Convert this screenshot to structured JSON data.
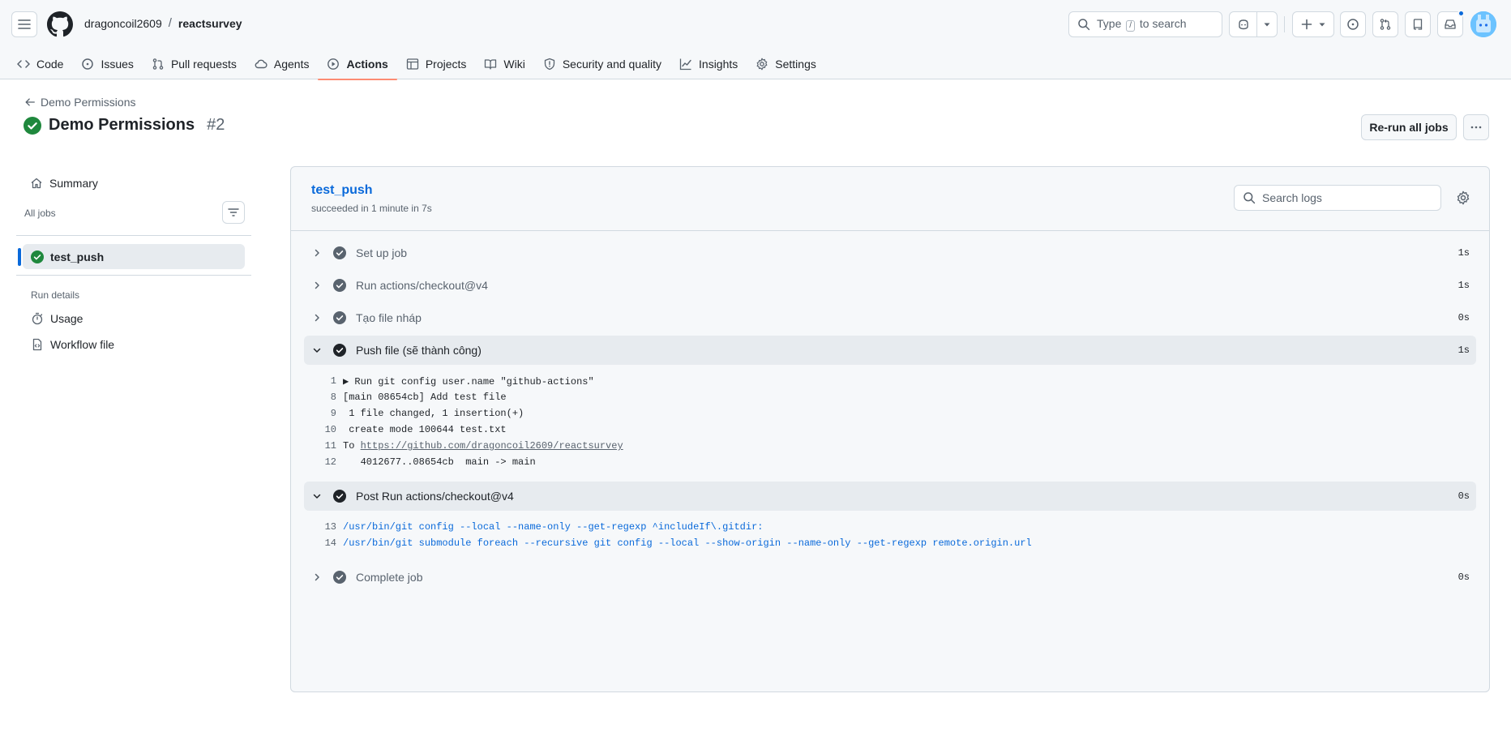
{
  "header": {
    "owner": "dragoncoil2609",
    "separator": "/",
    "repo": "reactsurvey",
    "search_text": "Type",
    "search_key": "/",
    "search_suffix": "to search"
  },
  "tabs": [
    {
      "label": "Code",
      "icon": "code-icon"
    },
    {
      "label": "Issues",
      "icon": "issue-icon"
    },
    {
      "label": "Pull requests",
      "icon": "pull-request-icon"
    },
    {
      "label": "Agents",
      "icon": "agents-icon"
    },
    {
      "label": "Actions",
      "icon": "play-icon",
      "active": true
    },
    {
      "label": "Projects",
      "icon": "table-icon"
    },
    {
      "label": "Wiki",
      "icon": "book-icon"
    },
    {
      "label": "Security and quality",
      "icon": "shield-icon"
    },
    {
      "label": "Insights",
      "icon": "graph-icon"
    },
    {
      "label": "Settings",
      "icon": "gear-icon"
    }
  ],
  "run": {
    "back_label": "Demo Permissions",
    "title": "Demo Permissions",
    "number": "#2",
    "rerun_label": "Re-run all jobs"
  },
  "sidebar": {
    "summary": "Summary",
    "all_jobs": "All jobs",
    "job": "test_push",
    "run_details": "Run details",
    "usage": "Usage",
    "workflow_file": "Workflow file"
  },
  "job": {
    "name": "test_push",
    "status": "succeeded in 1 minute in 7s",
    "search_placeholder": "Search logs"
  },
  "steps": [
    {
      "name": "Set up job",
      "duration": "1s",
      "expanded": false
    },
    {
      "name": "Run actions/checkout@v4",
      "duration": "1s",
      "expanded": false
    },
    {
      "name": "Tạo file nháp",
      "duration": "0s",
      "expanded": false
    },
    {
      "name": "Push file (sẽ thành công)",
      "duration": "1s",
      "expanded": true
    },
    {
      "name": "Post Run actions/checkout@v4",
      "duration": "0s",
      "expanded": true
    },
    {
      "name": "Complete job",
      "duration": "0s",
      "expanded": false
    }
  ],
  "logs_push": [
    {
      "n": "1",
      "text": "▶ Run git config user.name \"github-actions\""
    },
    {
      "n": "8",
      "text": "[main 08654cb] Add test file"
    },
    {
      "n": "9",
      "text": " 1 file changed, 1 insertion(+)"
    },
    {
      "n": "10",
      "text": " create mode 100644 test.txt"
    },
    {
      "n": "11",
      "text": "To ",
      "link": "https://github.com/dragoncoil2609/reactsurvey"
    },
    {
      "n": "12",
      "text": "   4012677..08654cb  main -> main"
    }
  ],
  "logs_post": [
    {
      "n": "13",
      "text": "/usr/bin/git config --local --name-only --get-regexp ^includeIf\\.gitdir:"
    },
    {
      "n": "14",
      "text": "/usr/bin/git submodule foreach --recursive git config --local --show-origin --name-only --get-regexp remote.origin.url"
    }
  ],
  "colors": {
    "success": "#1f883d",
    "step_done": "#59636e",
    "accent": "#0969da",
    "tab_underline": "#fd8c73"
  }
}
